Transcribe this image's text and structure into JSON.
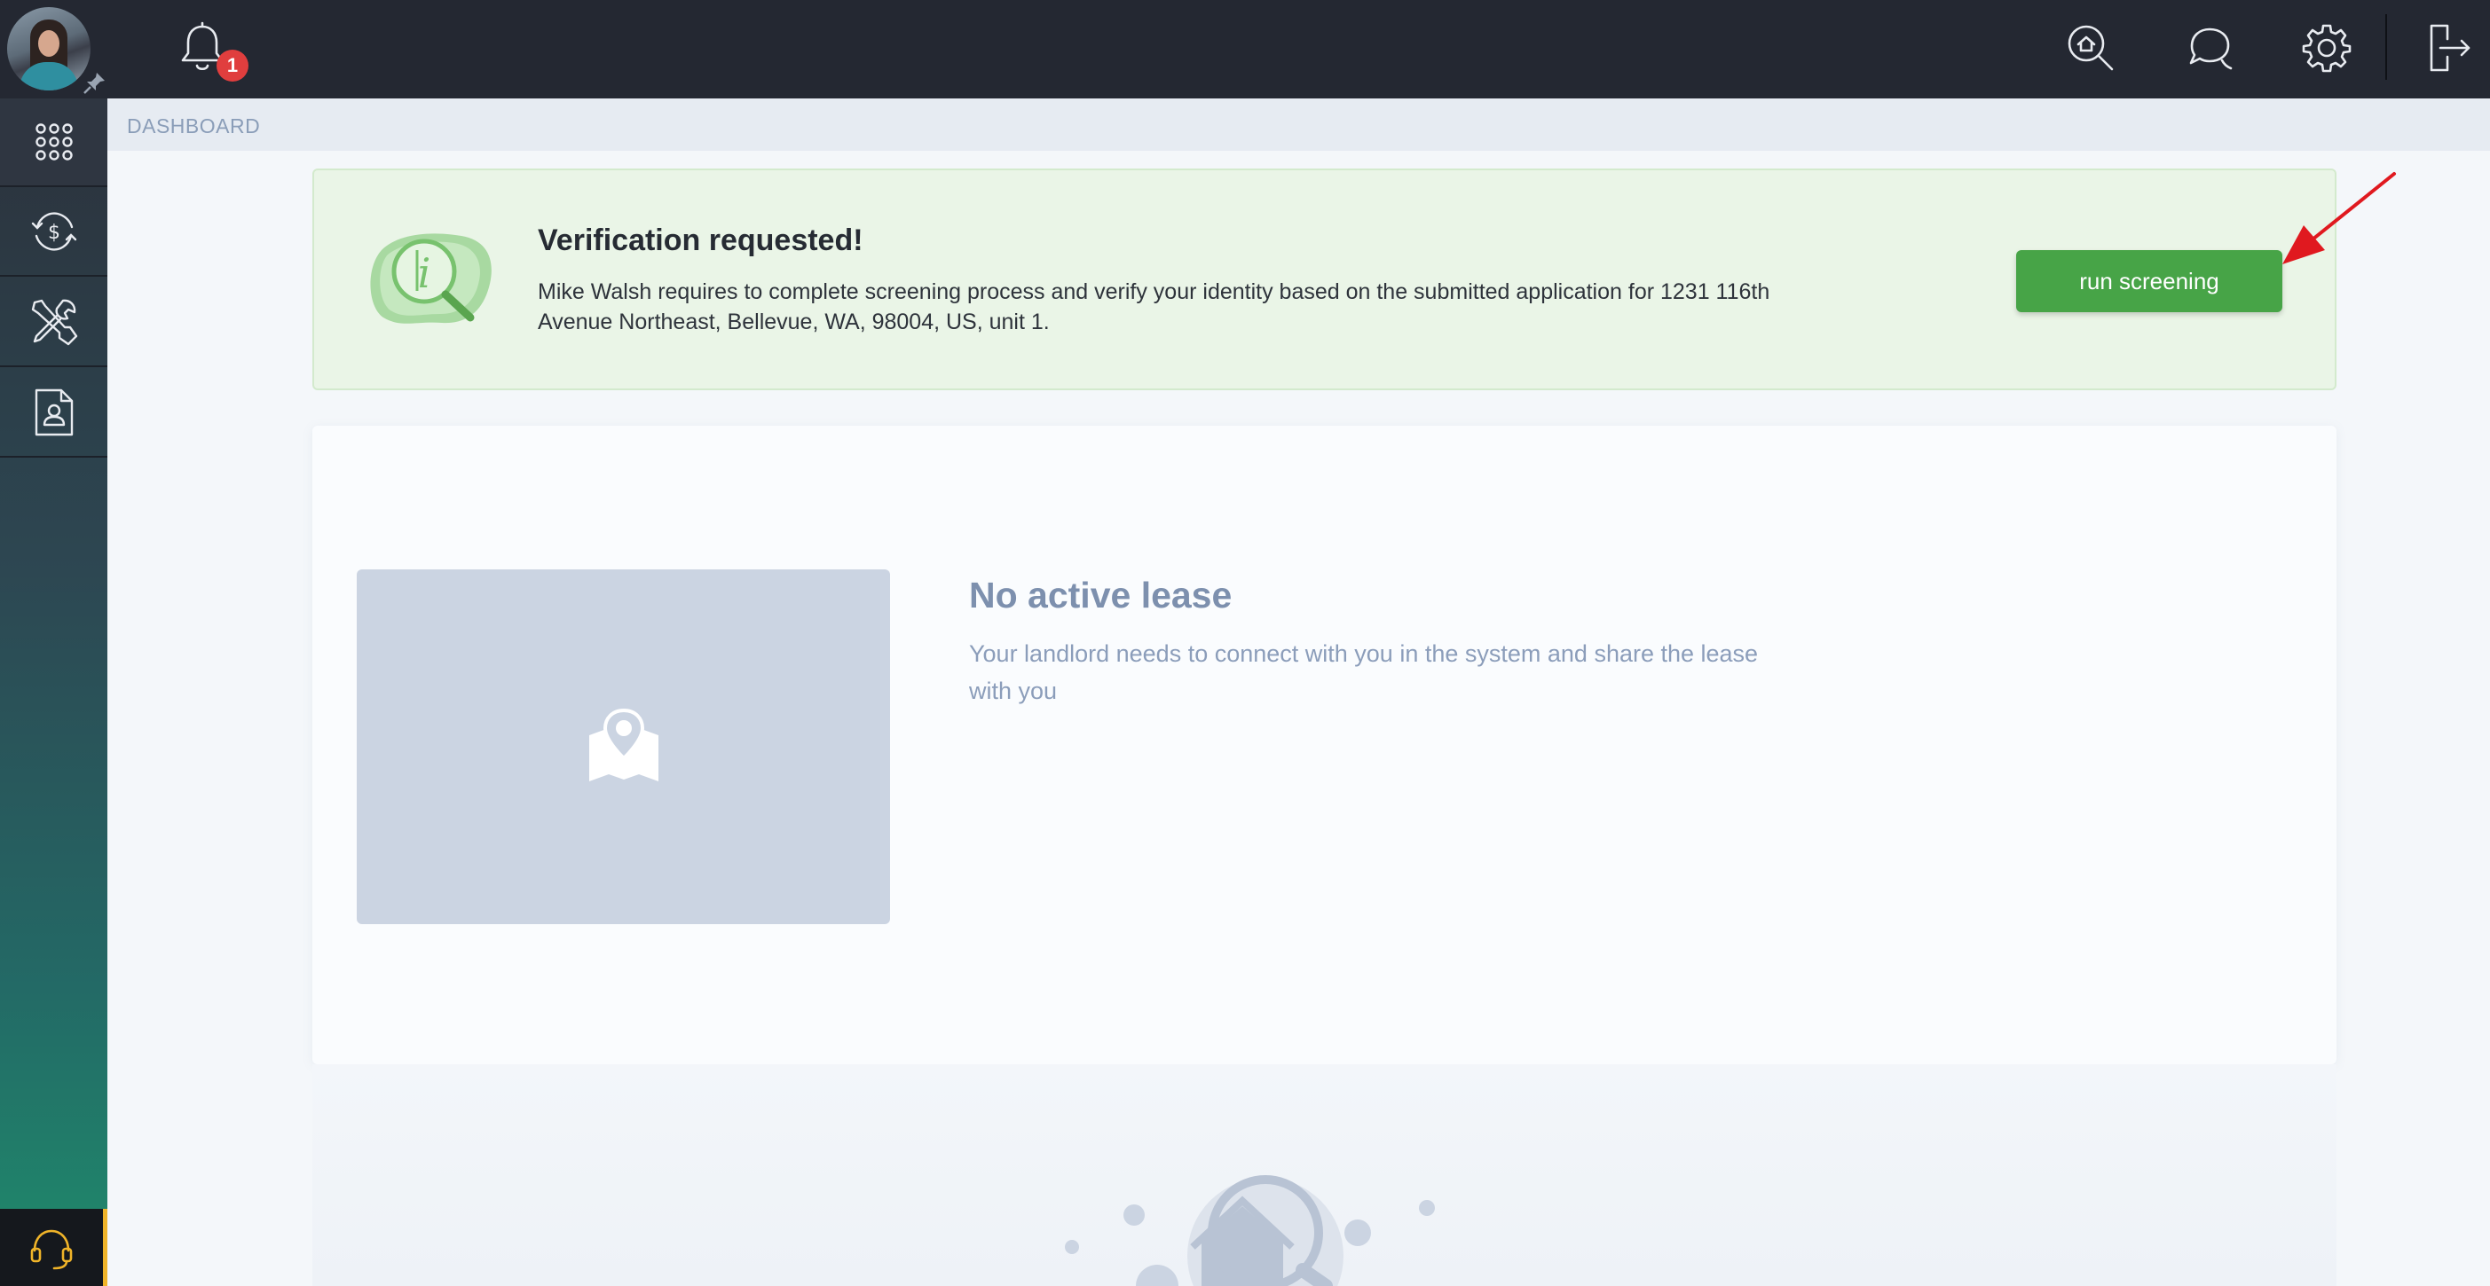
{
  "header": {
    "notification_count": "1",
    "icons": [
      "bell-icon",
      "search-home-icon",
      "chat-icon",
      "gear-icon",
      "logout-icon"
    ]
  },
  "sidebar": {
    "items": [
      {
        "icon": "apps-grid-icon",
        "active": true
      },
      {
        "icon": "payments-icon",
        "active": false
      },
      {
        "icon": "maintenance-tools-icon",
        "active": false
      },
      {
        "icon": "tenant-document-icon",
        "active": false
      }
    ],
    "support_icon": "headset-icon"
  },
  "breadcrumb": "DASHBOARD",
  "banner": {
    "title": "Verification requested!",
    "text": "Mike Walsh requires to complete screening process and verify your identity based on the submitted application for 1231 116th Avenue Northeast, Bellevue, WA, 98004, US, unit 1.",
    "button_label": "run screening"
  },
  "lease": {
    "title": "No active lease",
    "text": "Your landlord needs to connect with you in the system and share the lease with you"
  },
  "colors": {
    "topbar": "#242832",
    "accent_green": "#47a447",
    "badge_red": "#e03e3e",
    "annotation_arrow": "#e0191f",
    "support_accent": "#f0b429"
  }
}
